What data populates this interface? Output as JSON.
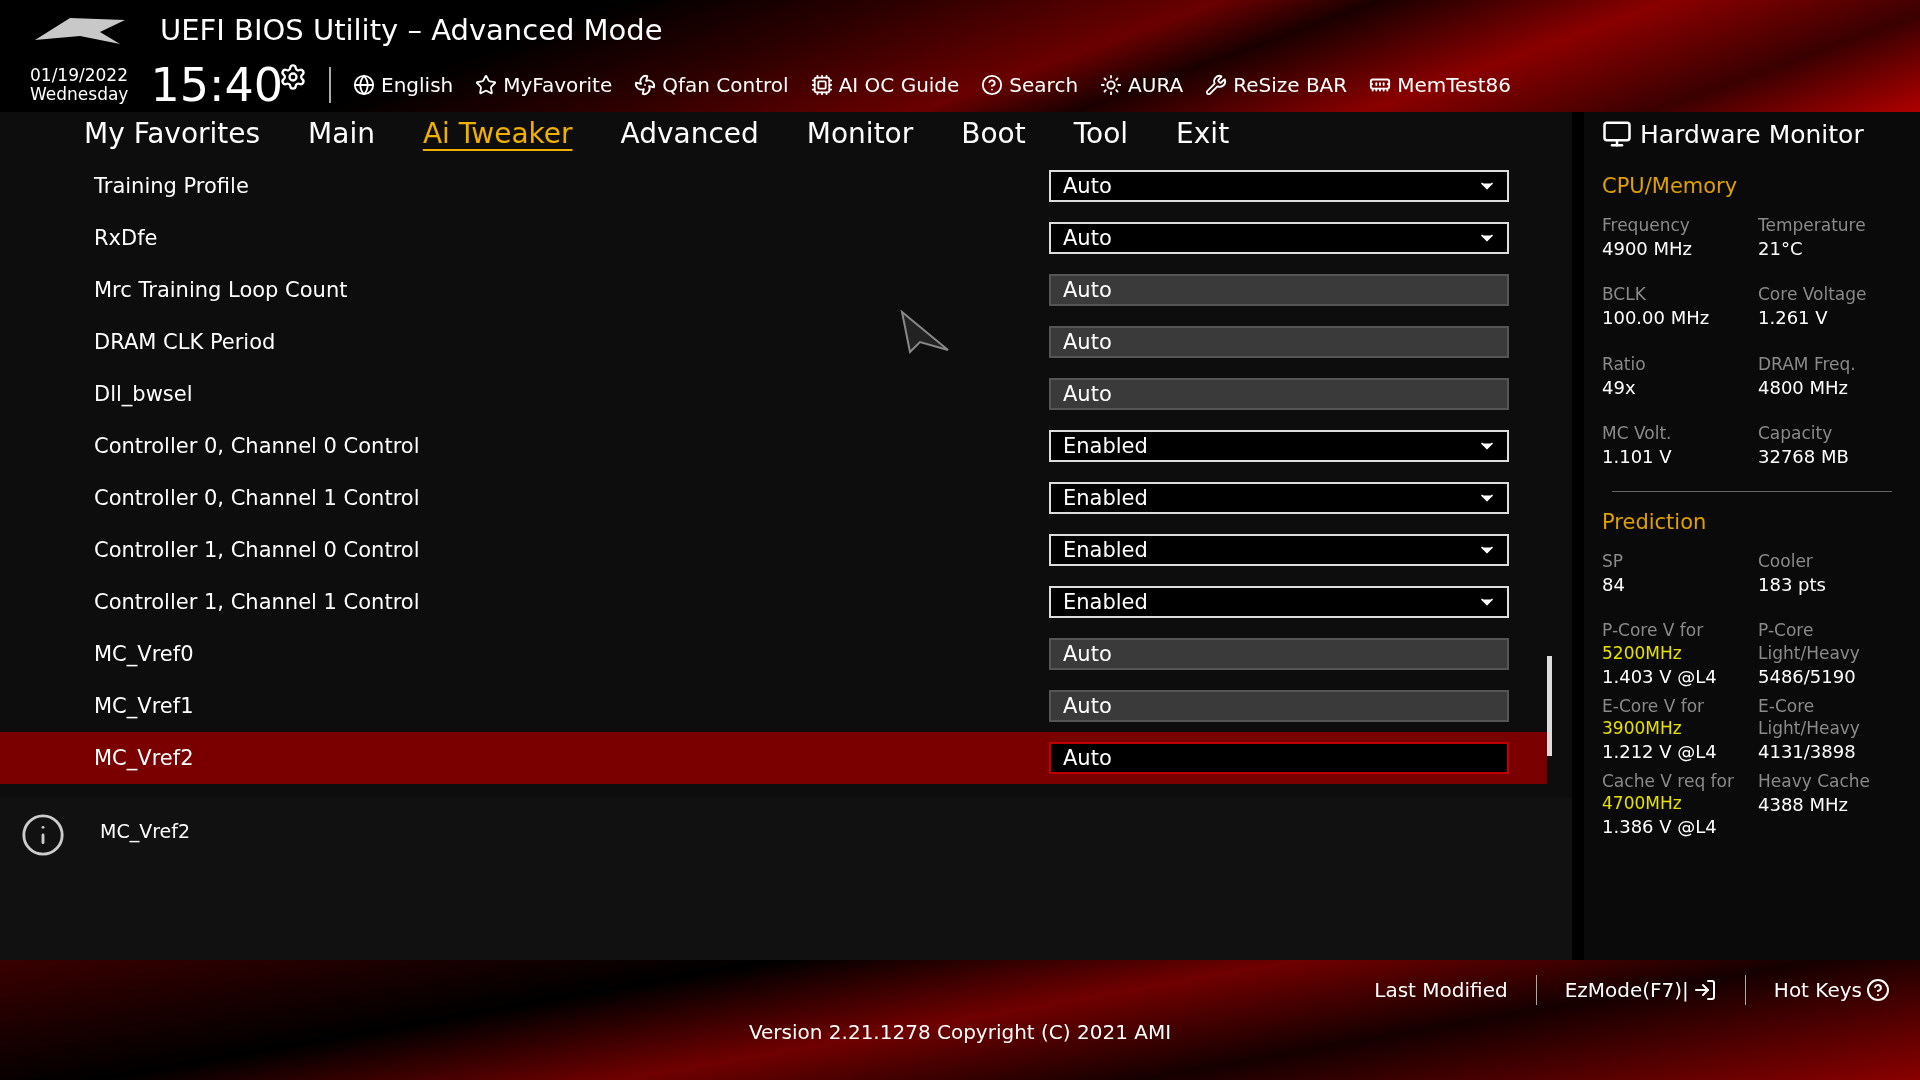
{
  "window": {
    "title": "UEFI BIOS Utility – Advanced Mode"
  },
  "datetime": {
    "date": "01/19/2022",
    "day": "Wednesday",
    "time": "15:40"
  },
  "toolbar": [
    {
      "kind": "globe",
      "label": "English"
    },
    {
      "kind": "star",
      "label": "MyFavorite"
    },
    {
      "kind": "fan",
      "label": "Qfan Control"
    },
    {
      "kind": "chip",
      "label": "AI OC Guide"
    },
    {
      "kind": "help",
      "label": "Search"
    },
    {
      "kind": "light",
      "label": "AURA"
    },
    {
      "kind": "bar",
      "label": "ReSize BAR"
    },
    {
      "kind": "mem",
      "label": "MemTest86"
    }
  ],
  "tabs": [
    {
      "label": "My Favorites",
      "selected": false
    },
    {
      "label": "Main",
      "selected": false
    },
    {
      "label": "Ai Tweaker",
      "selected": true
    },
    {
      "label": "Advanced",
      "selected": false
    },
    {
      "label": "Monitor",
      "selected": false
    },
    {
      "label": "Boot",
      "selected": false
    },
    {
      "label": "Tool",
      "selected": false
    },
    {
      "label": "Exit",
      "selected": false
    }
  ],
  "settings": [
    {
      "label": "Training Profile",
      "value": "Auto",
      "kind": "dropdown",
      "selected": false
    },
    {
      "label": "RxDfe",
      "value": "Auto",
      "kind": "dropdown",
      "selected": false
    },
    {
      "label": "Mrc Training Loop Count",
      "value": "Auto",
      "kind": "field",
      "selected": false
    },
    {
      "label": "DRAM CLK Period",
      "value": "Auto",
      "kind": "field",
      "selected": false
    },
    {
      "label": "Dll_bwsel",
      "value": "Auto",
      "kind": "field",
      "selected": false
    },
    {
      "label": "Controller 0, Channel 0 Control",
      "value": "Enabled",
      "kind": "dropdown",
      "selected": false
    },
    {
      "label": "Controller 0, Channel 1 Control",
      "value": "Enabled",
      "kind": "dropdown",
      "selected": false
    },
    {
      "label": "Controller 1, Channel 0 Control",
      "value": "Enabled",
      "kind": "dropdown",
      "selected": false
    },
    {
      "label": "Controller 1, Channel 1 Control",
      "value": "Enabled",
      "kind": "dropdown",
      "selected": false
    },
    {
      "label": "MC_Vref0",
      "value": "Auto",
      "kind": "field",
      "selected": false
    },
    {
      "label": "MC_Vref1",
      "value": "Auto",
      "kind": "field",
      "selected": false
    },
    {
      "label": "MC_Vref2",
      "value": "Auto",
      "kind": "field",
      "selected": true
    }
  ],
  "help": {
    "text": "MC_Vref2"
  },
  "hardware_monitor": {
    "title": "Hardware Monitor",
    "sections": [
      {
        "title": "CPU/Memory",
        "items": [
          {
            "label": "Frequency",
            "value": "4900 MHz"
          },
          {
            "label": "Temperature",
            "value": "21°C"
          },
          {
            "label": "BCLK",
            "value": "100.00 MHz"
          },
          {
            "label": "Core Voltage",
            "value": "1.261 V"
          },
          {
            "label": "Ratio",
            "value": "49x"
          },
          {
            "label": "DRAM Freq.",
            "value": "4800 MHz"
          },
          {
            "label": "MC Volt.",
            "value": "1.101 V"
          },
          {
            "label": "Capacity",
            "value": "32768 MB"
          }
        ]
      },
      {
        "title": "Prediction",
        "items": [
          {
            "label": "SP",
            "value": "84"
          },
          {
            "label": "Cooler",
            "value": "183 pts"
          },
          {
            "label": "P-Core V for",
            "highlight": "5200MHz",
            "value": "1.403 V @L4"
          },
          {
            "label": "P-Core Light/Heavy",
            "value": "5486/5190"
          },
          {
            "label": "E-Core V for",
            "highlight": "3900MHz",
            "value": "1.212 V @L4"
          },
          {
            "label": "E-Core Light/Heavy",
            "value": "4131/3898"
          },
          {
            "label": "Cache V req for",
            "highlight": "4700MHz",
            "value": "1.386 V @L4"
          },
          {
            "label": "Heavy Cache",
            "value": "4388 MHz"
          }
        ]
      }
    ]
  },
  "footer": {
    "buttons": [
      {
        "kind": "text",
        "label": "Last Modified"
      },
      {
        "kind": "exit",
        "label": "EzMode(F7)|"
      },
      {
        "kind": "help",
        "label": "Hot Keys"
      }
    ],
    "version": "Version 2.21.1278 Copyright (C) 2021 AMI"
  }
}
